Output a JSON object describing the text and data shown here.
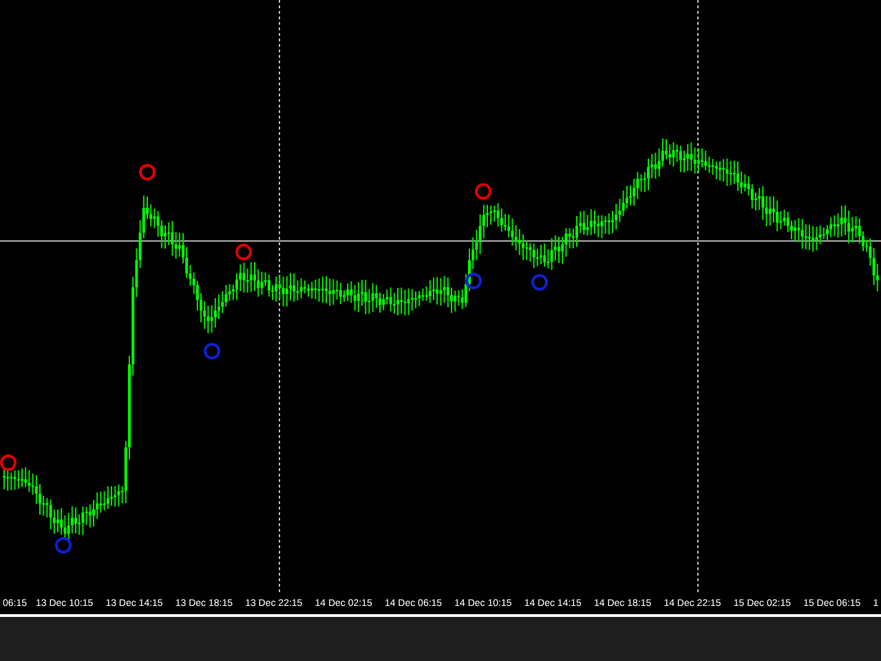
{
  "time_axis": {
    "labels": [
      "06:15",
      "13 Dec 10:15",
      "13 Dec 14:15",
      "13 Dec 18:15",
      "13 Dec 22:15",
      "14 Dec 02:15",
      "14 Dec 06:15",
      "14 Dec 10:15",
      "14 Dec 14:15",
      "14 Dec 18:15",
      "14 Dec 22:15",
      "15 Dec 02:15",
      "15 Dec 06:15",
      "1"
    ]
  }
}
